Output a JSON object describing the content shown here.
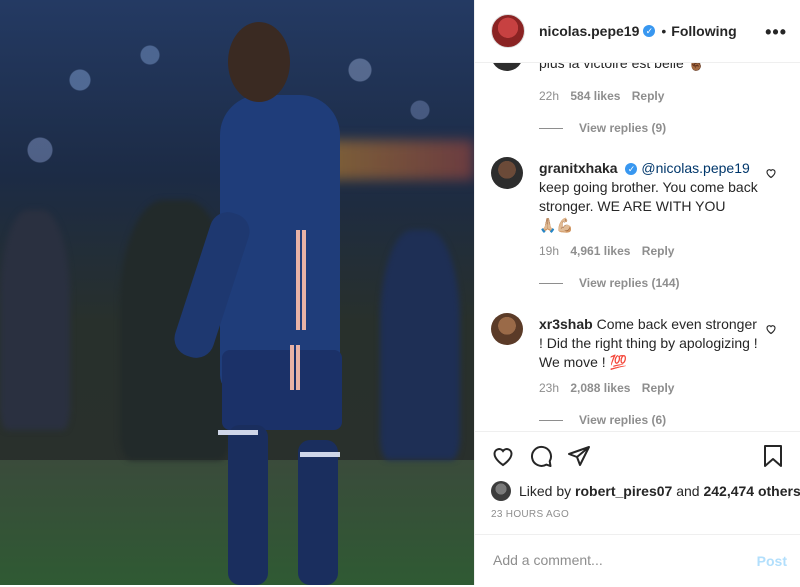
{
  "header": {
    "username": "nicolas.pepe19",
    "separator": "•",
    "follow_state": "Following",
    "more_icon": "more-dots-icon"
  },
  "comments": {
    "cut_text": "plus la victoire est belle 🤞🏾",
    "first_meta": {
      "time": "22h",
      "likes": "584 likes",
      "reply": "Reply"
    },
    "first_view_replies": "View replies (9)",
    "items": [
      {
        "user": "granitxhaka",
        "verified": true,
        "mention": "@nicolas.pepe19",
        "text": "keep going brother. You come back stronger. WE ARE WITH YOU",
        "emoji": "🙏🏼💪🏼",
        "time": "19h",
        "likes": "4,961 likes",
        "reply": "Reply",
        "view_replies": "View replies (144)"
      },
      {
        "user": "xr3shab",
        "verified": false,
        "text": "Come back even stronger ! Did the right thing by apologizing ! We move ! 💯",
        "time": "23h",
        "likes": "2,088 likes",
        "reply": "Reply",
        "view_replies": "View replies (6)"
      }
    ]
  },
  "actions": {
    "like_icon": "heart-icon",
    "comment_icon": "comment-icon",
    "share_icon": "share-icon",
    "save_icon": "bookmark-icon"
  },
  "likes": {
    "prefix": "Liked by",
    "user": "robert_pires07",
    "middle": "and",
    "count": "242,474 others"
  },
  "time_ago": "23 HOURS AGO",
  "add_comment": {
    "placeholder": "Add a comment...",
    "post_label": "Post"
  },
  "colors": {
    "accent": "#3897f0",
    "post_disabled": "#b2dffc",
    "muted": "#8e8e8e"
  }
}
